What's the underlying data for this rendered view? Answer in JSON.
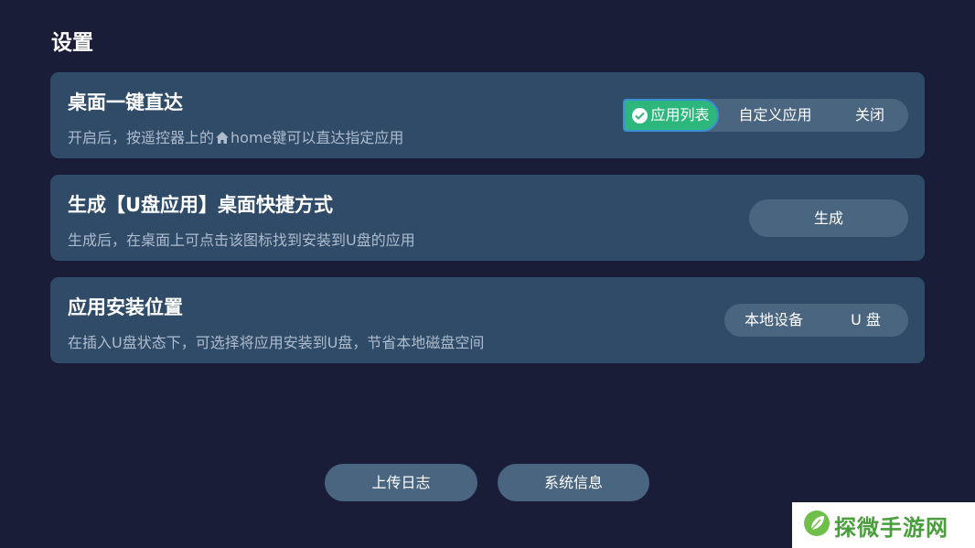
{
  "page": {
    "title": "设置"
  },
  "settings": [
    {
      "title": "桌面一键直达",
      "desc_before": "开启后，按遥控器上的",
      "desc_icon": "home-icon",
      "desc_after": "home键可以直达指定应用",
      "options": [
        "应用列表",
        "自定义应用",
        "关闭"
      ],
      "selected": "应用列表"
    },
    {
      "title": "生成【U盘应用】桌面快捷方式",
      "desc": "生成后，在桌面上可点击该图标找到安装到U盘的应用",
      "button": "生成"
    },
    {
      "title": "应用安装位置",
      "desc": "在插入U盘状态下，可选择将应用安装到U盘，节省本地磁盘空间",
      "options": [
        "本地设备",
        "U 盘"
      ]
    }
  ],
  "footer": {
    "upload_log": "上传日志",
    "system_info": "系统信息"
  },
  "watermark": {
    "text": "探微手游网"
  },
  "colors": {
    "background": "#1a1d38",
    "card": "#2f4b68",
    "pill": "#4a6580",
    "accent_selected": "#2eb77c",
    "focus_border": "#3a8fd6"
  }
}
